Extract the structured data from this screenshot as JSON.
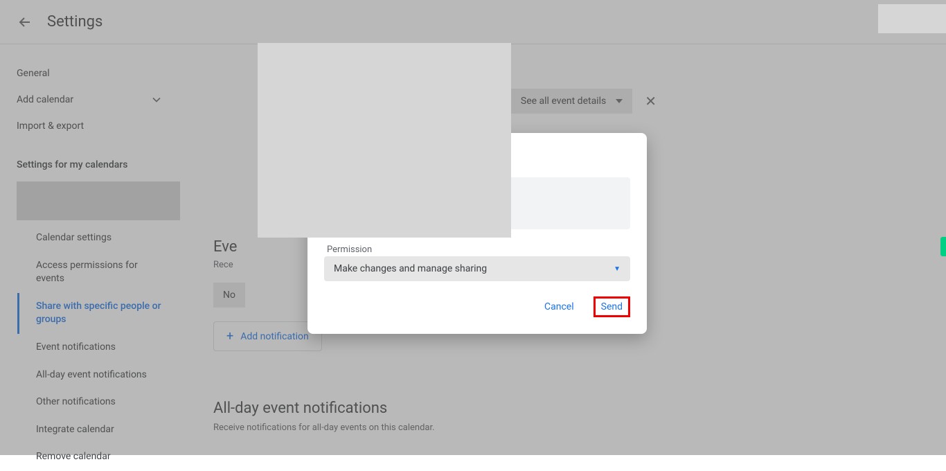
{
  "header": {
    "title": "Settings"
  },
  "sidebar": {
    "general": "General",
    "add_calendar": "Add calendar",
    "import_export": "Import & export",
    "section_heading": "Settings for my calendars",
    "subnav": {
      "calendar_settings": "Calendar settings",
      "access_permissions": "Access permissions for events",
      "share_specific": "Share with specific people or groups",
      "event_notifications": "Event notifications",
      "all_day_notifications": "All-day event notifications",
      "other_notifications": "Other notifications",
      "integrate_calendar": "Integrate calendar",
      "remove_calendar": "Remove calendar"
    }
  },
  "main": {
    "see_all_label": "See all event details",
    "eve_label_cut": "Eve",
    "receive_cut": "Rece",
    "notif_chip": "No",
    "add_notification": "Add notification",
    "allday_title": "All-day event notifications",
    "allday_sub": "Receive notifications for all-day events on this calendar."
  },
  "modal": {
    "permission_label": "Permission",
    "permission_value": "Make changes and manage sharing",
    "cancel": "Cancel",
    "send": "Send"
  }
}
